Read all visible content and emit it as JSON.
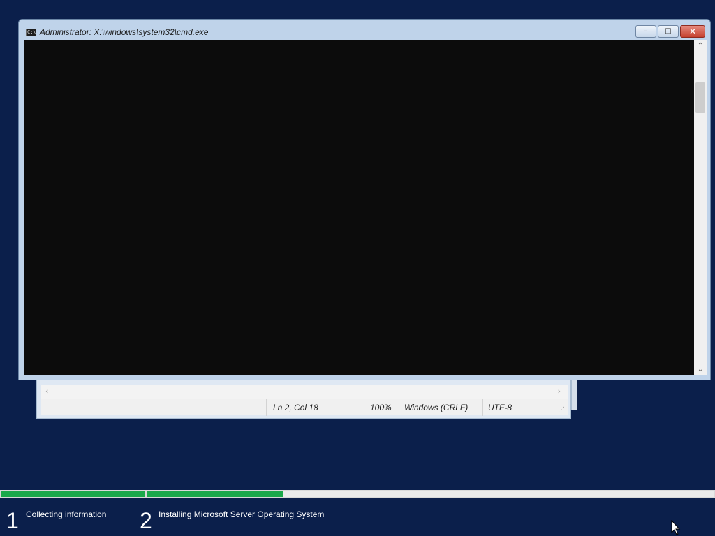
{
  "notepad": {
    "status": {
      "position": "Ln 2, Col 18",
      "zoom": "100%",
      "line_endings": "Windows (CRLF)",
      "encoding": "UTF-8"
    }
  },
  "cmd": {
    "title": "Administrator: X:\\windows\\system32\\cmd.exe",
    "icon_text": "C:\\"
  },
  "setup": {
    "steps": [
      {
        "number": "1",
        "label": "Collecting information",
        "progress": 1.0
      },
      {
        "number": "2",
        "label": "Installing Microsoft Server Operating System",
        "progress": 0.24
      }
    ],
    "colors": {
      "background": "#0b1f4b",
      "progress": "#1ba84a"
    }
  }
}
